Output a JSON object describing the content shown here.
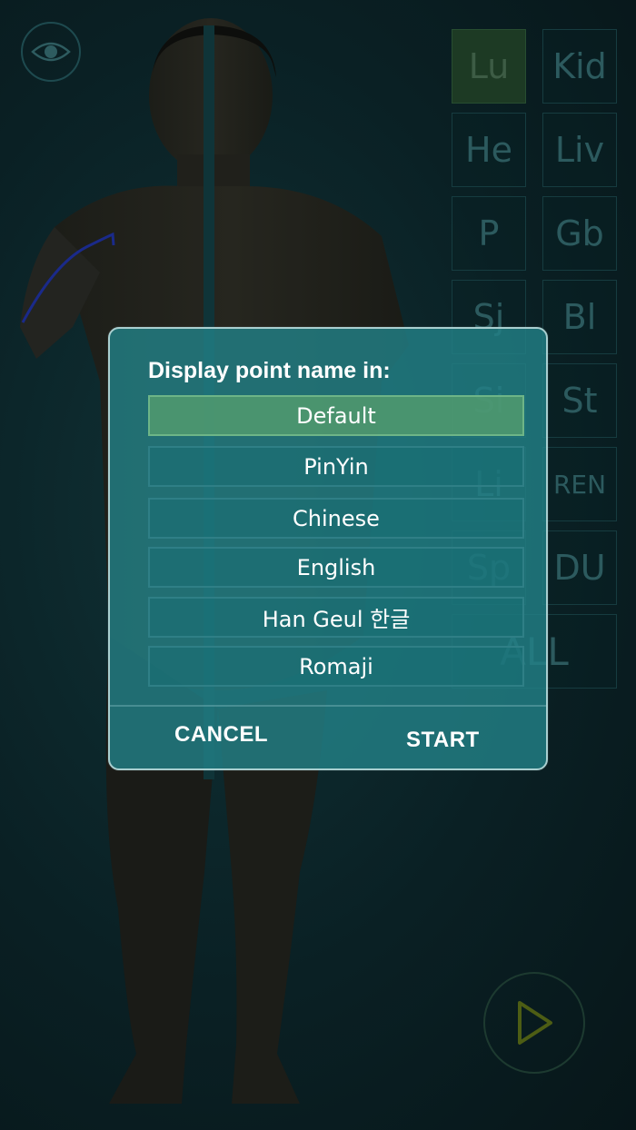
{
  "meridians": {
    "cells": [
      "Lu",
      "Kid",
      "He",
      "Liv",
      "P",
      "Gb",
      "Sj",
      "Bl",
      "Si",
      "St",
      "Li",
      "REN",
      "Sp",
      "DU"
    ],
    "all_label": "ALL",
    "active": "Lu"
  },
  "icons": {
    "eye": "eye-icon",
    "play": "play-icon"
  },
  "dialog": {
    "title": "Display point name in:",
    "options": [
      "Default",
      "PinYin",
      "Chinese",
      "English",
      "Han Geul 한글",
      "Romaji"
    ],
    "selected": "Default",
    "cancel_label": "CANCEL",
    "start_label": "START"
  },
  "colors": {
    "dialog_bg": "#22808a",
    "selected_option": "#58a06e",
    "active_meridian": "#1d3a24"
  }
}
